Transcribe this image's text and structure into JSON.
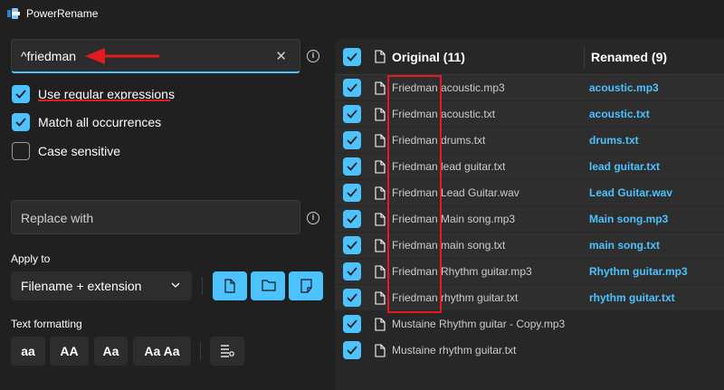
{
  "window": {
    "title": "PowerRename"
  },
  "search": {
    "value": "^friedman"
  },
  "options": [
    {
      "label": "Use regular expressions",
      "checked": true
    },
    {
      "label": "Match all occurrences",
      "checked": true
    },
    {
      "label": "Case sensitive",
      "checked": false
    }
  ],
  "replace": {
    "placeholder": "Replace with"
  },
  "apply_to": {
    "label": "Apply to",
    "selected": "Filename + extension"
  },
  "text_formatting": {
    "label": "Text formatting",
    "buttons": [
      "aa",
      "AA",
      "Aa",
      "Aa Aa"
    ]
  },
  "table": {
    "original_header": "Original (11)",
    "renamed_header": "Renamed (9)",
    "rows": [
      {
        "original": "Friedman acoustic.mp3",
        "renamed": "acoustic.mp3"
      },
      {
        "original": "Friedman acoustic.txt",
        "renamed": "acoustic.txt"
      },
      {
        "original": "Friedman drums.txt",
        "renamed": "drums.txt"
      },
      {
        "original": "Friedman lead guitar.txt",
        "renamed": "lead guitar.txt"
      },
      {
        "original": "Friedman Lead Guitar.wav",
        "renamed": "Lead Guitar.wav"
      },
      {
        "original": "Friedman Main song.mp3",
        "renamed": "Main song.mp3"
      },
      {
        "original": "Friedman main song.txt",
        "renamed": "main song.txt"
      },
      {
        "original": "Friedman Rhythm guitar.mp3",
        "renamed": "Rhythm guitar.mp3"
      },
      {
        "original": "Friedman rhythm guitar.txt",
        "renamed": "rhythm guitar.txt"
      },
      {
        "original": "Mustaine Rhythm guitar - Copy.mp3",
        "renamed": ""
      },
      {
        "original": "Mustaine rhythm guitar.txt",
        "renamed": ""
      }
    ]
  },
  "colors": {
    "accent": "#4cc2ff",
    "annotation": "#e01b24",
    "background": "#202020"
  }
}
